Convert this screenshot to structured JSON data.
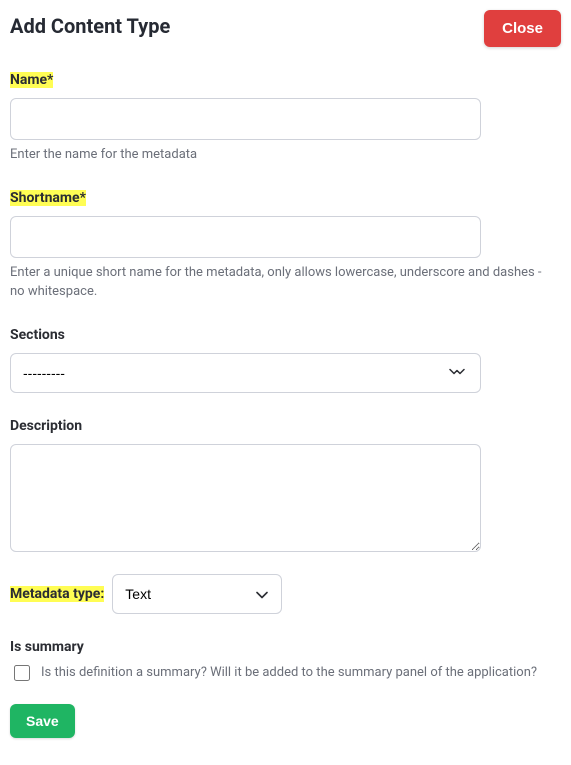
{
  "header": {
    "title": "Add Content Type",
    "close_label": "Close"
  },
  "fields": {
    "name": {
      "label": "Name*",
      "value": "",
      "help": "Enter the name for the metadata"
    },
    "shortname": {
      "label": "Shortname*",
      "value": "",
      "help": "Enter a unique short name for the metadata, only allows lowercase, underscore and dashes - no whitespace."
    },
    "sections": {
      "label": "Sections",
      "selected": "---------"
    },
    "description": {
      "label": "Description",
      "value": ""
    },
    "metadata_type": {
      "label": "Metadata type:",
      "selected": "Text"
    },
    "is_summary": {
      "label": "Is summary",
      "checkbox_text": "Is this definition a summary? Will it be added to the summary panel of the application?"
    }
  },
  "actions": {
    "save_label": "Save"
  }
}
